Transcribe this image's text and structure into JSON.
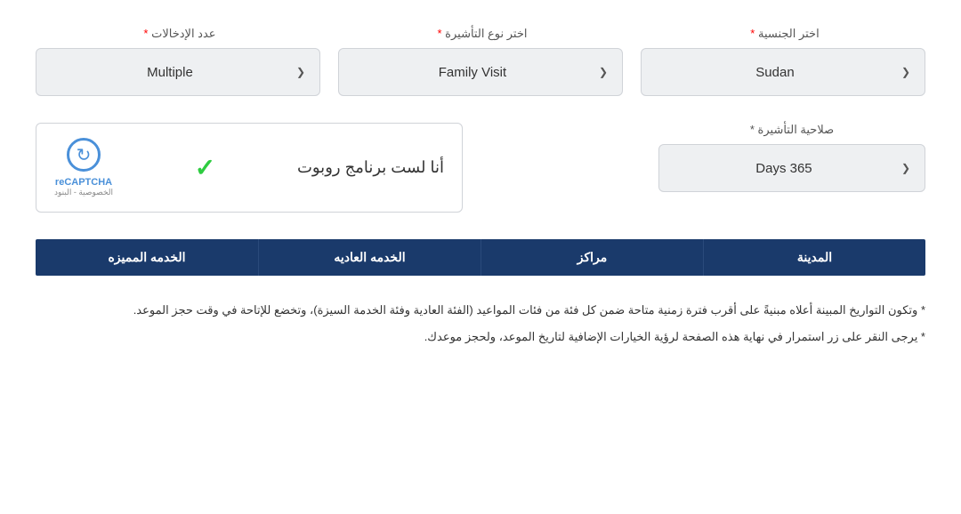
{
  "page": {
    "dropdowns": [
      {
        "label": "اختر الجنسية",
        "required": true,
        "value": "Sudan",
        "name": "nationality-dropdown"
      },
      {
        "label": "اختر نوع التأشيرة",
        "required": true,
        "value": "Family Visit",
        "name": "visa-type-dropdown"
      },
      {
        "label": "عدد الإدخالات",
        "required": true,
        "value": "Multiple",
        "name": "entries-dropdown"
      }
    ],
    "validity": {
      "label": "صلاحية التأشيرة",
      "required": true,
      "value": "Days 365",
      "name": "validity-dropdown"
    },
    "captcha": {
      "text": "أنا لست برنامج روبوت",
      "brand_name": "reCAPTCHA",
      "brand_sub": "الخصوصية - البنود",
      "checked": true
    },
    "table": {
      "headers": [
        "المدينة",
        "مراكز",
        "الخدمه العاديه",
        "الخدمه المميزه"
      ]
    },
    "notes": [
      "* وتكون التواريخ المبينة أعلاه مبنيةً على أقرب فترة زمنية متاحة ضمن كل فئة من فئات المواعيد (الفئة العادية وفئة الخدمة السيزة)، وتخضع للإتاحة في وقت حجز الموعد.",
      "* يرجى النقر على زر استمرار في نهاية هذه الصفحة لرؤية الخيارات الإضافية لتاريخ الموعد، ولحجز موعدك."
    ]
  }
}
